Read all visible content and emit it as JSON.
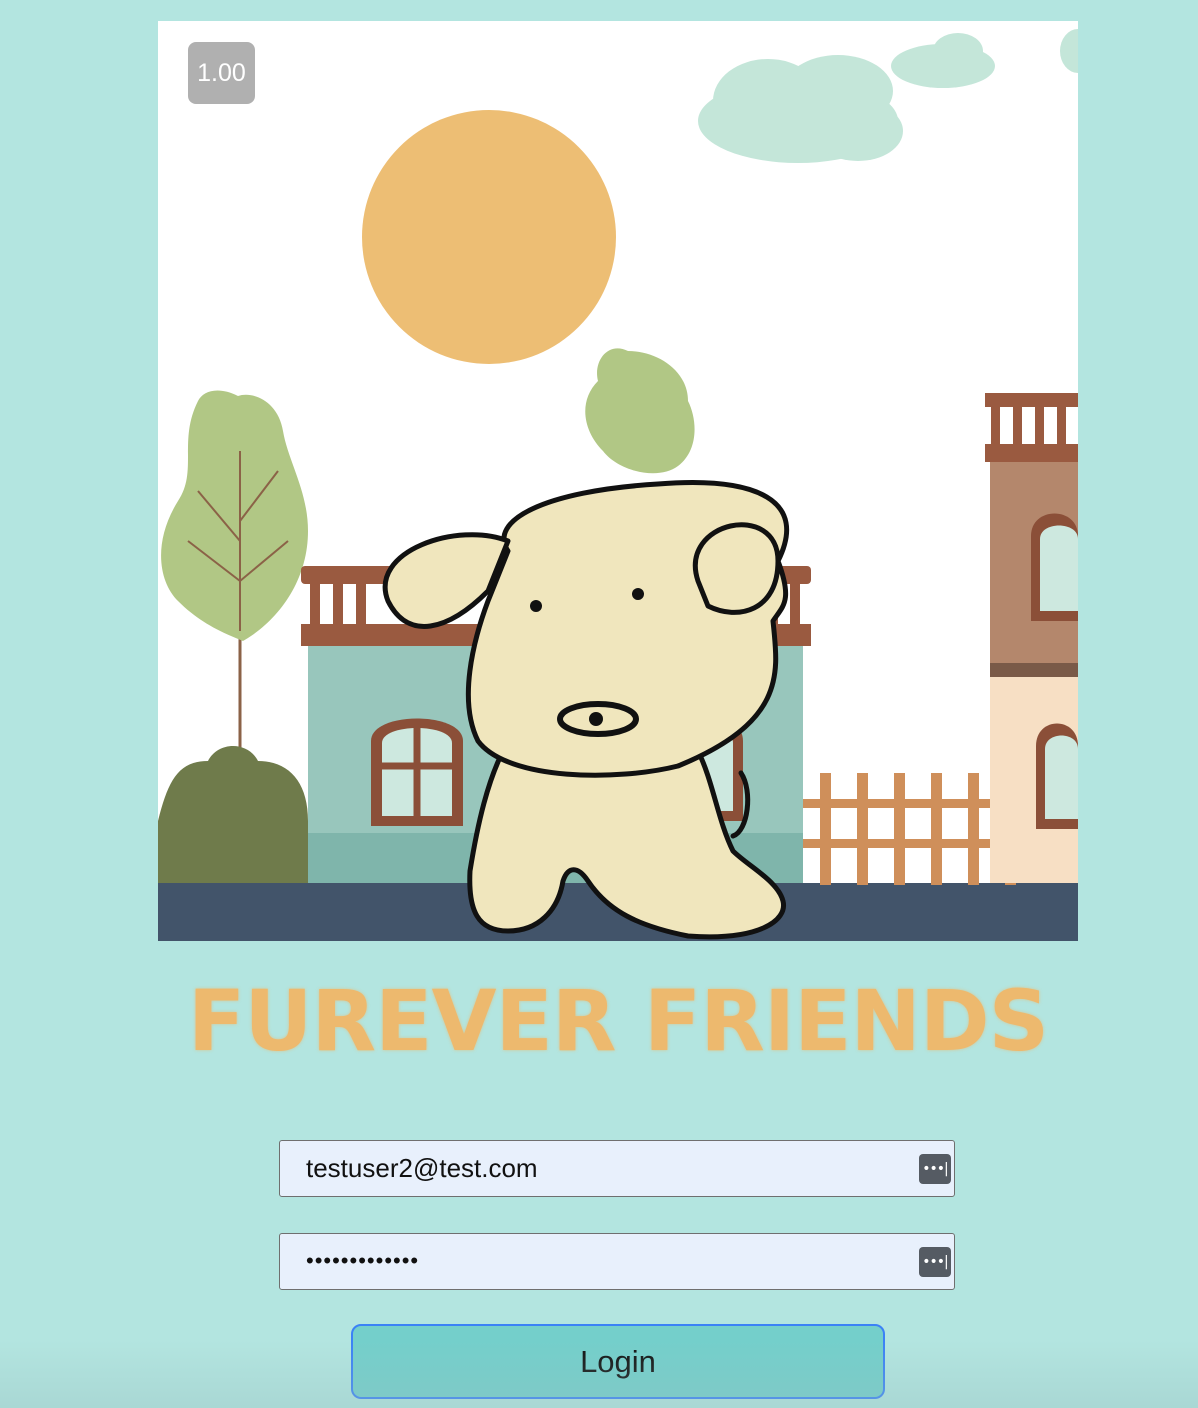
{
  "video": {
    "playback_speed": "1.00"
  },
  "brand": {
    "title": "FUREVER FRIENDS"
  },
  "login_form": {
    "email_value": "testuser2@test.com",
    "password_value": "•••••••••••••",
    "password_manager_icon": "key-dots-icon",
    "login_label": "Login"
  },
  "colors": {
    "background": "#b3e5e0",
    "title": "#edb96e",
    "button": "#74cfcb",
    "button_border": "#3b82f6",
    "field_bg": "#e8f0fc"
  }
}
